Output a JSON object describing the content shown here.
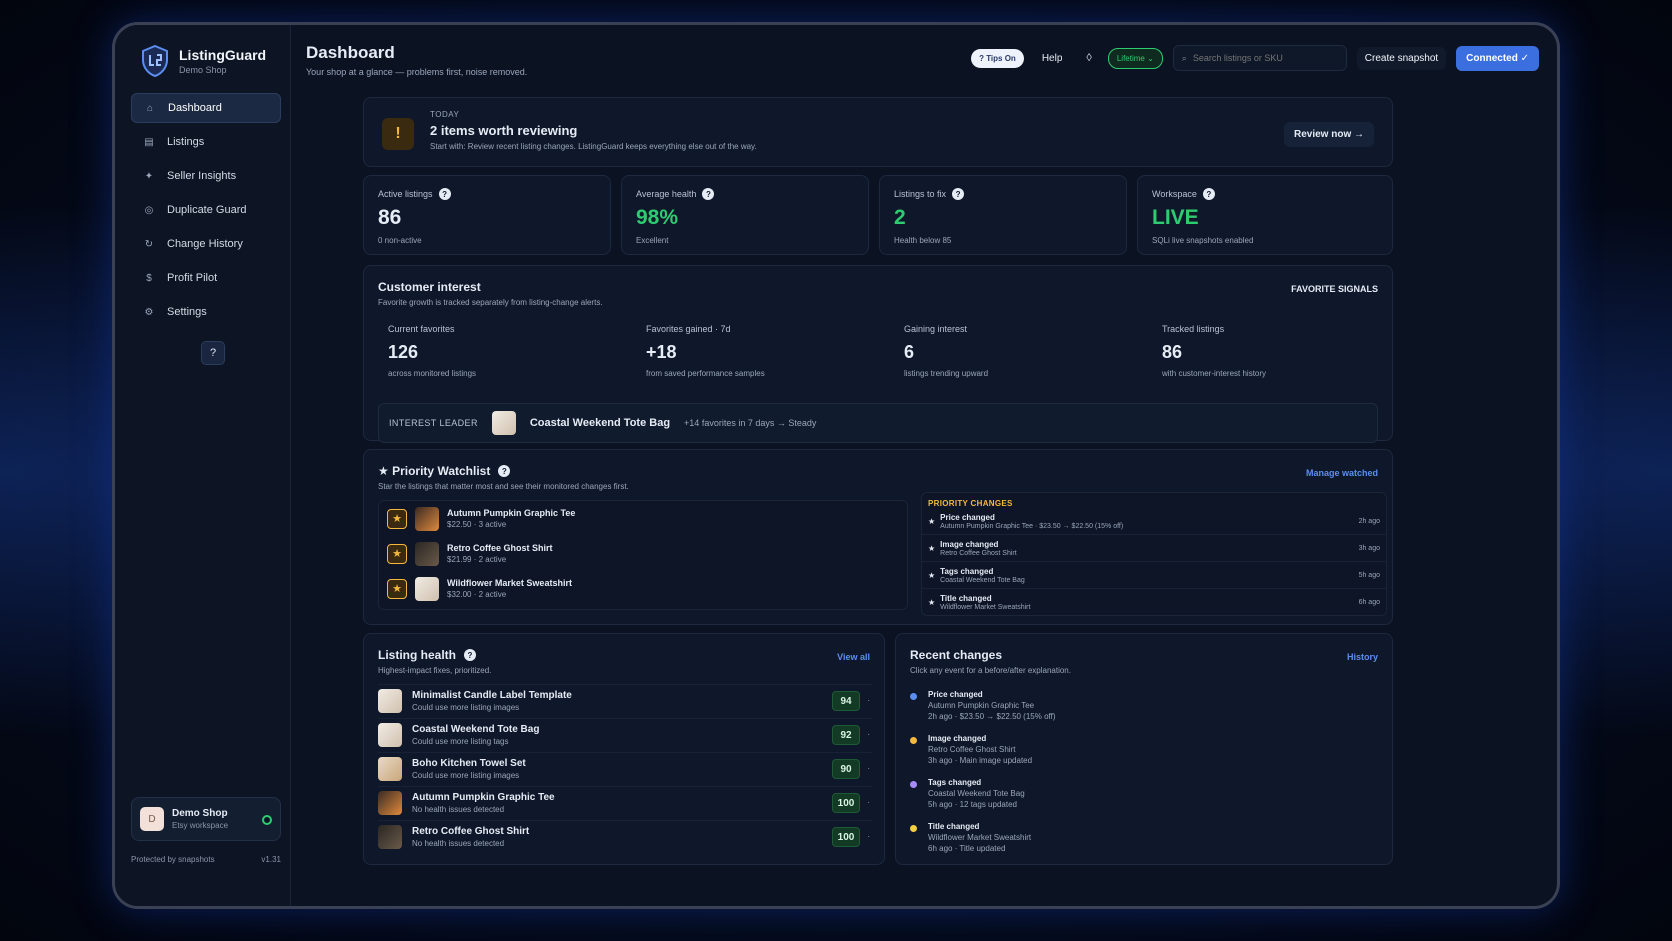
{
  "app": {
    "name": "ListingGuard",
    "shop": "Demo Shop"
  },
  "nav": [
    {
      "label": "Dashboard",
      "icon": "home-icon",
      "glyph": "⌂"
    },
    {
      "label": "Listings",
      "icon": "list-icon",
      "glyph": "▤"
    },
    {
      "label": "Seller Insights",
      "icon": "sparkle-icon",
      "glyph": "✦"
    },
    {
      "label": "Duplicate Guard",
      "icon": "target-icon",
      "glyph": "◎"
    },
    {
      "label": "Change History",
      "icon": "history-icon",
      "glyph": "↻"
    },
    {
      "label": "Profit Pilot",
      "icon": "dollar-icon",
      "glyph": "$"
    },
    {
      "label": "Settings",
      "icon": "gear-icon",
      "glyph": "⚙"
    }
  ],
  "help_icon_glyph": "?",
  "shop_card": {
    "avatar": "D",
    "name": "Demo Shop",
    "sub": "Etsy workspace"
  },
  "footer": {
    "left": "Protected by snapshots",
    "right": "v1.31"
  },
  "header": {
    "title": "Dashboard",
    "subtitle": "Your shop at a glance — problems first, noise removed."
  },
  "topbar": {
    "tips": "? Tips On",
    "help": "Help",
    "diamond": "◊",
    "lifetime": "Lifetime ⌄",
    "search_placeholder": "Search listings or SKU",
    "snapshot": "Create snapshot",
    "connected": "Connected ✓"
  },
  "alert": {
    "icon": "!",
    "cap": "TODAY",
    "title": "2 items worth reviewing",
    "sub": "Start with: Review recent listing changes. ListingGuard keeps everything else out of the way.",
    "button": "Review now →"
  },
  "stats": [
    {
      "label": "Active listings",
      "value": "86",
      "sub": "0 non-active",
      "color": "#e6ecf5"
    },
    {
      "label": "Average health",
      "value": "98%",
      "sub": "Excellent",
      "color": "#2ecc71"
    },
    {
      "label": "Listings to fix",
      "value": "2",
      "sub": "Health below 85",
      "color": "#2ecc71"
    },
    {
      "label": "Workspace",
      "value": "LIVE",
      "sub": "SQLi live snapshots enabled",
      "color": "#2ecc71"
    }
  ],
  "interest": {
    "title": "Customer interest",
    "sub": "Favorite growth is tracked separately from listing-change alerts.",
    "tag": "FAVORITE SIGNALS",
    "cells": [
      {
        "label": "Current favorites",
        "value": "126",
        "sub": "across monitored listings"
      },
      {
        "label": "Favorites gained · 7d",
        "value": "+18",
        "sub": "from saved performance samples"
      },
      {
        "label": "Gaining interest",
        "value": "6",
        "sub": "listings trending upward"
      },
      {
        "label": "Tracked listings",
        "value": "86",
        "sub": "with customer-interest history"
      }
    ],
    "leader": {
      "cap": "INTEREST LEADER",
      "name": "Coastal Weekend Tote Bag",
      "detail": "+14 favorites in 7 days → Steady"
    }
  },
  "watchlist": {
    "title": "★ Priority Watchlist",
    "sub": "Star the listings that matter most and see their monitored changes first.",
    "link": "Manage watched",
    "items": [
      {
        "name": "Autumn Pumpkin Graphic Tee",
        "sub": "$22.50 · 3 active"
      },
      {
        "name": "Retro Coffee Ghost Shirt",
        "sub": "$21.99 · 2 active"
      },
      {
        "name": "Wildflower Market Sweatshirt",
        "sub": "$32.00 · 2 active"
      }
    ],
    "changes_head": "PRIORITY CHANGES",
    "changes": [
      {
        "title": "Price changed",
        "sub": "Autumn Pumpkin Graphic Tee · $23.50 → $22.50 (15% off)",
        "time": "2h ago"
      },
      {
        "title": "Image changed",
        "sub": "Retro Coffee Ghost Shirt",
        "time": "3h ago"
      },
      {
        "title": "Tags changed",
        "sub": "Coastal Weekend Tote Bag",
        "time": "5h ago"
      },
      {
        "title": "Title changed",
        "sub": "Wildflower Market Sweatshirt",
        "time": "6h ago"
      }
    ]
  },
  "health": {
    "title": "Listing health",
    "sub": "Highest-impact fixes, prioritized.",
    "link": "View all",
    "rows": [
      {
        "name": "Minimalist Candle Label Template",
        "sub": "Could use more listing images",
        "score": "94"
      },
      {
        "name": "Coastal Weekend Tote Bag",
        "sub": "Could use more listing tags",
        "score": "92"
      },
      {
        "name": "Boho Kitchen Towel Set",
        "sub": "Could use more listing images",
        "score": "90"
      },
      {
        "name": "Autumn Pumpkin Graphic Tee",
        "sub": "No health issues detected",
        "score": "100"
      },
      {
        "name": "Retro Coffee Ghost Shirt",
        "sub": "No health issues detected",
        "score": "100"
      }
    ]
  },
  "recent": {
    "title": "Recent changes",
    "sub": "Click any event for a before/after explanation.",
    "link": "History",
    "rows": [
      {
        "title": "Price changed",
        "l1": "Autumn Pumpkin Graphic Tee",
        "l2": "2h ago · $23.50 → $22.50 (15% off)",
        "color": "#5b8ef0"
      },
      {
        "title": "Image changed",
        "l1": "Retro Coffee Ghost Shirt",
        "l2": "3h ago · Main image updated",
        "color": "#f5b83d"
      },
      {
        "title": "Tags changed",
        "l1": "Coastal Weekend Tote Bag",
        "l2": "5h ago · 12 tags updated",
        "color": "#a78bfa"
      },
      {
        "title": "Title changed",
        "l1": "Wildflower Market Sweatshirt",
        "l2": "6h ago · Title updated",
        "color": "#f5d03d"
      }
    ]
  }
}
